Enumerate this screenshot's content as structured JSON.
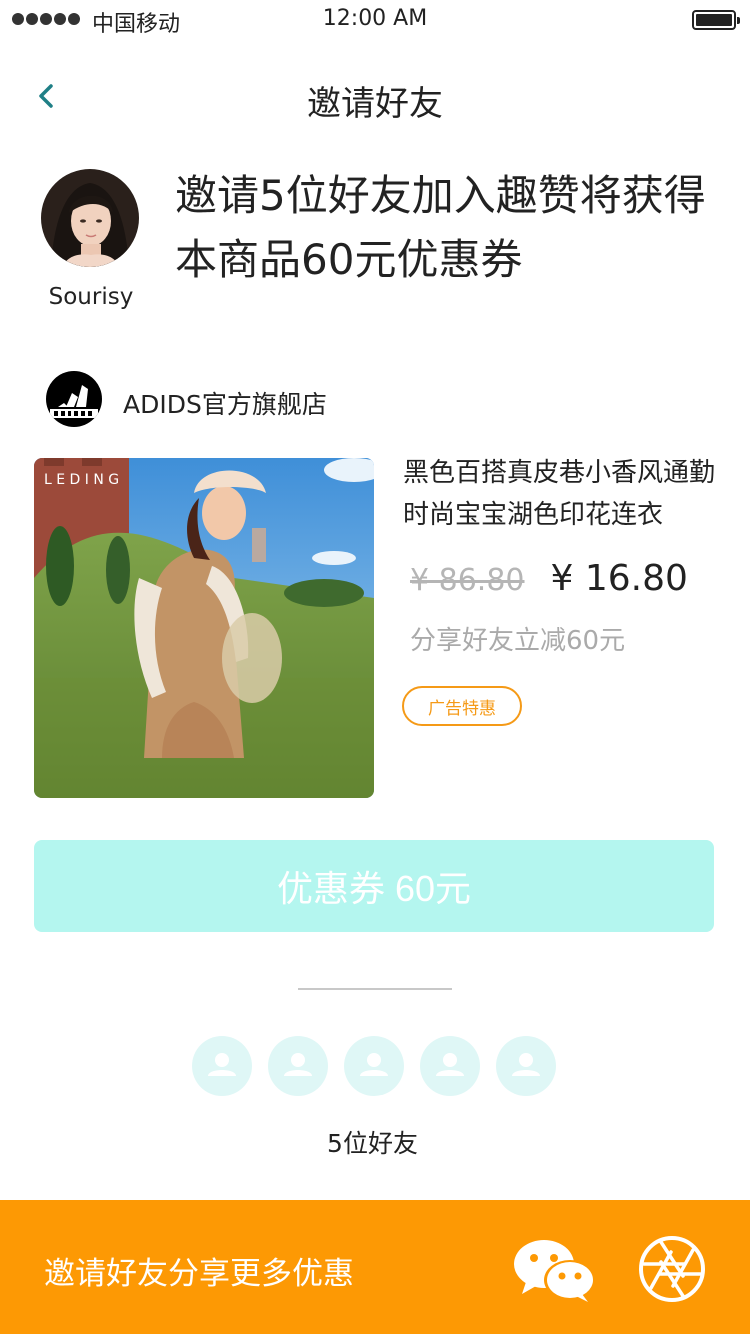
{
  "status_bar": {
    "carrier": "中国移动",
    "time": "12:00 AM",
    "signal_icon": "signal-dots-icon",
    "battery_icon": "battery-icon"
  },
  "nav": {
    "title": "邀请好友",
    "back_icon": "chevron-left-icon"
  },
  "inviter": {
    "name": "Sourisy",
    "headline": "邀请5位好友加入趣赞将获得本商品60元优惠券"
  },
  "shop": {
    "name": "ADIDS官方旗舰店",
    "logo": "adidas-logo"
  },
  "product": {
    "image_watermark": "L E D I N G",
    "title": "黑色百搭真皮巷小香风通勤时尚宝宝湖色印花连衣",
    "price_original": "¥ 86.80",
    "price_current": "¥ 16.80",
    "share_note": "分享好友立减60元",
    "badge": "广告特惠"
  },
  "coupon": {
    "label": "优惠券 60元"
  },
  "friends": {
    "slots": [
      "user-icon",
      "user-icon",
      "user-icon",
      "user-icon",
      "user-icon"
    ],
    "label": "5位好友"
  },
  "bottom_bar": {
    "text": "邀请好友分享更多优惠",
    "wechat_icon": "wechat-icon",
    "moments_icon": "moments-aperture-icon"
  },
  "colors": {
    "accent_teal": "#1f7f86",
    "coupon_bg": "#b4f6ef",
    "friend_slot_bg": "#dff7f6",
    "friend_icon": "#ffffff",
    "badge_orange": "#f59a17",
    "bottom_bar_bg": "#fd9904",
    "price_muted": "#b5b5b5"
  }
}
